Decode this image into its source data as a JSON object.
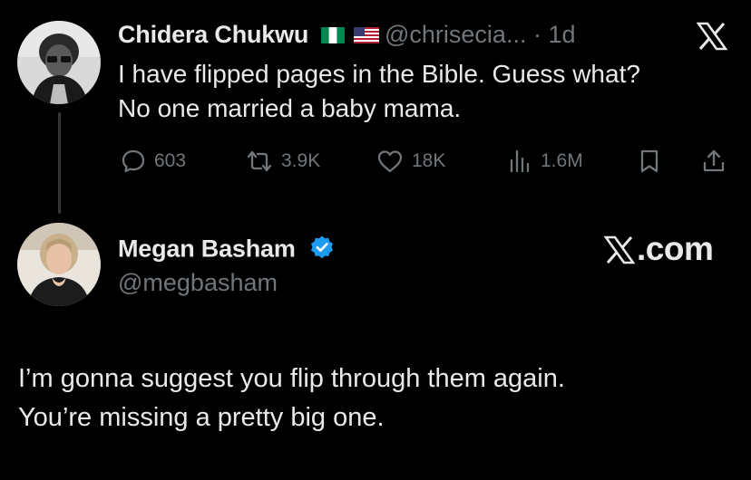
{
  "original_tweet": {
    "author_name": "Chidera Chukwu",
    "flags": [
      "nigeria-flag",
      "usa-flag"
    ],
    "handle_time": "@chrisecia... · 1d",
    "text_lines": [
      "I have flipped pages in the Bible. Guess what?",
      "No one married a baby mama."
    ],
    "stats": {
      "replies": "603",
      "reposts": "3.9K",
      "likes": "18K",
      "views": "1.6M"
    }
  },
  "reply": {
    "author_name": "Megan Basham",
    "handle": "@megbasham",
    "verified": true,
    "text_lines": [
      "I’m gonna suggest you flip through them again.",
      "You’re missing a pretty big one."
    ]
  },
  "brand_label": ".com",
  "colors": {
    "background": "#000000",
    "text": "#e7e9ea",
    "muted": "#71767b",
    "verified": "#1d9bf0",
    "thread_line": "#333639"
  }
}
